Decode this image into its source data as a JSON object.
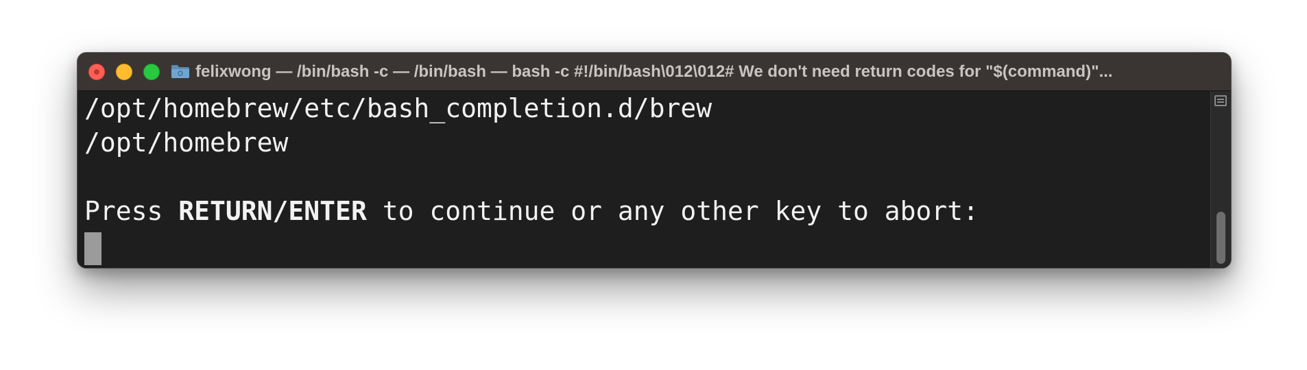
{
  "window": {
    "title": "felixwong — /bin/bash -c  — /bin/bash — bash -c #!/bin/bash\\012\\012# We don't need return codes for \"$(command)\"..."
  },
  "icons": {
    "close": "close-button",
    "minimize": "minimize-button",
    "zoom": "zoom-button",
    "folder": "folder-icon",
    "scroll_menu": "list-icon"
  },
  "colors": {
    "close": "#ff5f57",
    "minimize": "#febc2e",
    "zoom": "#28c840",
    "terminal_bg": "#1e1e1e",
    "terminal_fg": "#f2f2f2",
    "titlebar_bg": "#3a3533"
  },
  "terminal": {
    "line1": "/opt/homebrew/etc/bash_completion.d/brew",
    "line2": "/opt/homebrew",
    "line3": "",
    "prompt_prefix": "Press ",
    "prompt_bold": "RETURN/ENTER",
    "prompt_suffix": " to continue or any other key to abort:"
  }
}
